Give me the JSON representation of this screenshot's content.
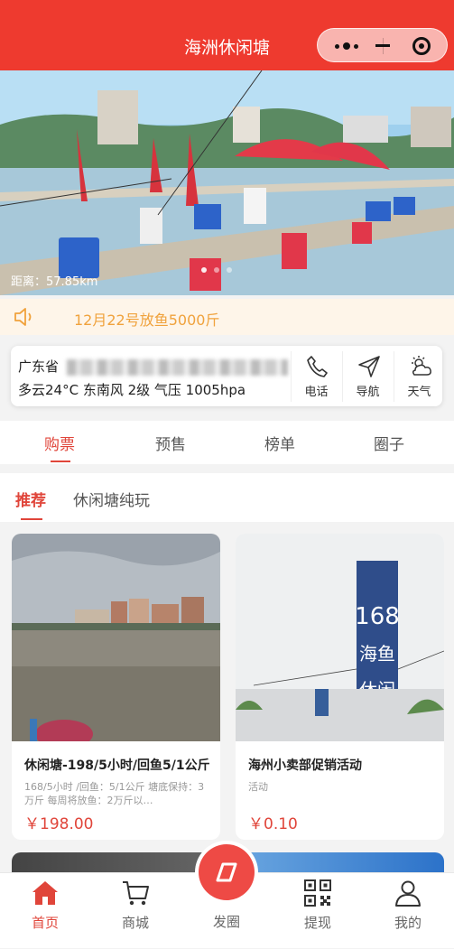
{
  "header": {
    "title": "海洲休闲塘"
  },
  "banner": {
    "distance": "距离：57.85km"
  },
  "notice": {
    "text": "12月22号放鱼5000斤"
  },
  "info": {
    "address": "广东省",
    "weather": "多云24°C  东南风 2级 气压 1005hpa",
    "actions": [
      "电话",
      "导航",
      "天气"
    ]
  },
  "tabs": [
    "购票",
    "预售",
    "榜单",
    "圈子"
  ],
  "subtabs": [
    "推荐",
    "休闲塘纯玩"
  ],
  "products": [
    {
      "name": "休闲塘-198/5小时/回鱼5/1公斤",
      "desc": "168/5小时 /回鱼：5/1公斤 塘底保持：3万斤 每周将放鱼：2万斤以…",
      "price": "￥198.00"
    },
    {
      "name": "海州小卖部促销活动",
      "desc": "活动",
      "price": "￥0.10"
    }
  ],
  "nav": [
    "首页",
    "商城",
    "发圈",
    "提现",
    "我的"
  ],
  "colors": {
    "brand": "#ee3a2f",
    "accent": "#e0453a",
    "notice": "#f0a23c"
  }
}
